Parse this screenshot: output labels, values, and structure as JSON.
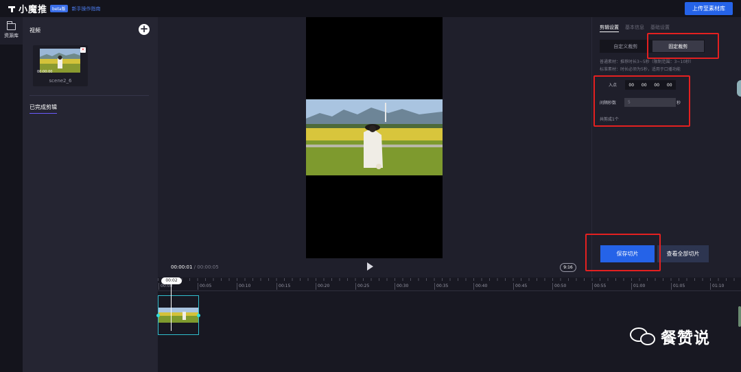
{
  "header": {
    "logo_text": "小魔推",
    "beta": "beta版",
    "guide": "新手操作指南",
    "upload_button": "上传至素材库"
  },
  "rail": {
    "label": "资源库"
  },
  "library": {
    "section_title": "视频",
    "clip": {
      "time": "00:00:00",
      "name": "scene2_6"
    },
    "done_title": "已完成剪辑"
  },
  "player": {
    "current_time": "00:00:01",
    "separator": " / ",
    "total_time": "00:00:05",
    "ratio": "9:16"
  },
  "settings": {
    "tabs": [
      "剪辑设置",
      "基本信息",
      "基础设置"
    ],
    "modes": [
      "自定义裁剪",
      "固定裁剪"
    ],
    "tip1": "普通素材：推荐时长3~5秒（限制范围：3~10秒）",
    "tip2": "标准素材：时长必须为5秒，适用于口播功能",
    "in_point_label": "入点",
    "in_point": [
      "00",
      "00",
      "00",
      "00"
    ],
    "interval_label": "间隔秒数",
    "interval_value": "5",
    "unit": "秒",
    "count": "共剪成1个",
    "save_button": "保存切片",
    "view_all_button": "查看全部切片"
  },
  "timeline": {
    "playhead": "00:02",
    "ticks": [
      "00:00",
      "00:05",
      "00:10",
      "00:15",
      "00:20",
      "00:25",
      "00:30",
      "00:35",
      "00:40",
      "00:45",
      "00:50",
      "00:55",
      "01:00",
      "01:05",
      "01:10"
    ]
  },
  "watermark": {
    "text": "餐赞说"
  },
  "colors": {
    "accent": "#2563e8",
    "highlight": "#e52020",
    "clip_border": "#30c0d0"
  }
}
